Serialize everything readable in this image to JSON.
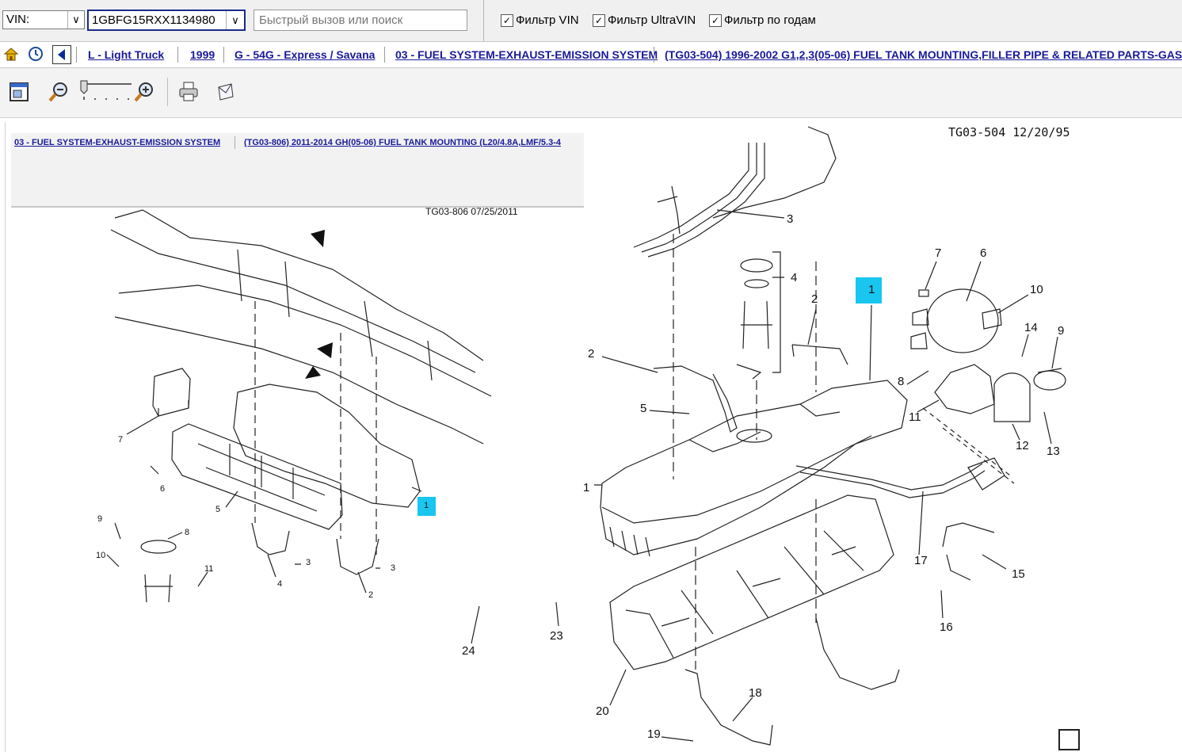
{
  "topbar": {
    "vin_select_label": "VIN:",
    "vin_value": "1GBFG15RXX1134980",
    "search_placeholder": "Быстрый вызов или поиск",
    "filters": [
      {
        "label": "Фильтр VIN",
        "checked": true
      },
      {
        "label": "Фильтр UltraVIN",
        "checked": true
      },
      {
        "label": "Фильтр по годам",
        "checked": true
      }
    ]
  },
  "breadcrumb": {
    "items": [
      "L - Light Truck",
      "1999",
      "G - 54G - Express / Savana",
      "03 - FUEL SYSTEM-EXHAUST-EMISSION SYSTEM",
      "(TG03-504)   1996-2002   G1,2,3(05-06) FUEL TANK MOUNTING,FILLER PIPE & RELATED PARTS-GAS"
    ]
  },
  "inner_breadcrumb": {
    "items": [
      "03 - FUEL SYSTEM-EXHAUST-EMISSION SYSTEM",
      "(TG03-806)   2011-2014   GH(05-06) FUEL TANK MOUNTING (L20/4.8A,LMF/5.3-4"
    ]
  },
  "diagram_right": {
    "code": "TG03-504 12/20/95",
    "highlight_callout": "1",
    "callouts": [
      "1",
      "2",
      "2",
      "3",
      "4",
      "5",
      "6",
      "7",
      "8",
      "9",
      "10",
      "11",
      "12",
      "13",
      "14",
      "15",
      "16",
      "17",
      "18",
      "19",
      "20",
      "23",
      "24"
    ]
  },
  "diagram_left": {
    "code": "TG03-806  07/25/2011",
    "highlight_callout": "1",
    "callouts": [
      "2",
      "3",
      "3",
      "4",
      "5",
      "6",
      "7",
      "8",
      "9",
      "10",
      "11"
    ]
  }
}
